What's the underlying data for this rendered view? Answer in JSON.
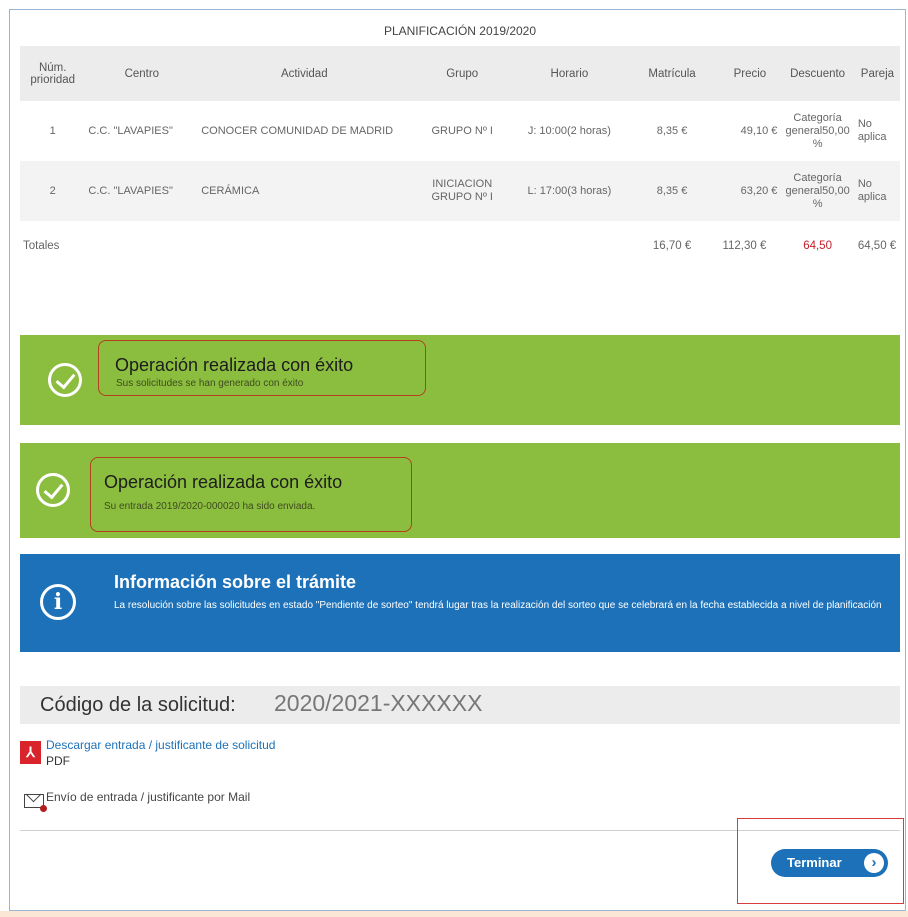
{
  "table": {
    "title": "PLANIFICACIÓN 2019/2020",
    "headers": [
      "Núm. prioridad",
      "Centro",
      "Actividad",
      "Grupo",
      "Horario",
      "Matrícula",
      "Precio",
      "Descuento",
      "Pareja"
    ],
    "rows": [
      {
        "num": "1",
        "centro": "C.C. \"LAVAPIES\"",
        "actividad": "CONOCER COMUNIDAD DE MADRID",
        "grupo": "GRUPO Nº I",
        "horario": "J: 10:00(2 horas)",
        "matricula": "8,35 €",
        "precio": "49,10 €",
        "descuento": "Categoría general50,00 %",
        "pareja": "No aplica"
      },
      {
        "num": "2",
        "centro": "C.C. \"LAVAPIES\"",
        "actividad": "CERÁMICA",
        "grupo": "INICIACION GRUPO Nº I",
        "horario": "L: 17:00(3 horas)",
        "matricula": "8,35 €",
        "precio": "63,20 €",
        "descuento": "Categoría general50,00 %",
        "pareja": "No aplica"
      }
    ],
    "totals": {
      "label": "Totales",
      "matricula": "16,70 €",
      "precio": "112,30 €",
      "descuento": "64,50",
      "pareja": "64,50 €"
    }
  },
  "messages": {
    "success1": {
      "title": "Operación realizada con éxito",
      "text": "Sus solicitudes se han generado con éxito"
    },
    "success2": {
      "title": "Operación realizada con éxito",
      "text": "Su entrada 2019/2020-000020 ha sido enviada."
    },
    "info": {
      "title": "Información sobre el trámite",
      "text": "La resolución sobre las solicitudes en estado \"Pendiente de sorteo\" tendrá lugar tras la realización del sorteo que se celebrará en la fecha establecida a nivel de planificación"
    }
  },
  "code": {
    "label": "Código de la solicitud:",
    "value": "2020/2021-XXXXXX"
  },
  "downloads": {
    "pdf_link": "Descargar entrada / justificante de solicitud",
    "pdf_label": "PDF",
    "mail_link": "Envío de entrada / justificante por Mail"
  },
  "actions": {
    "finish": "Terminar"
  },
  "colors": {
    "success": "#8bbd3f",
    "info": "#1d71b8",
    "highlight": "#b3401e",
    "discount_total": "#c3202a"
  }
}
